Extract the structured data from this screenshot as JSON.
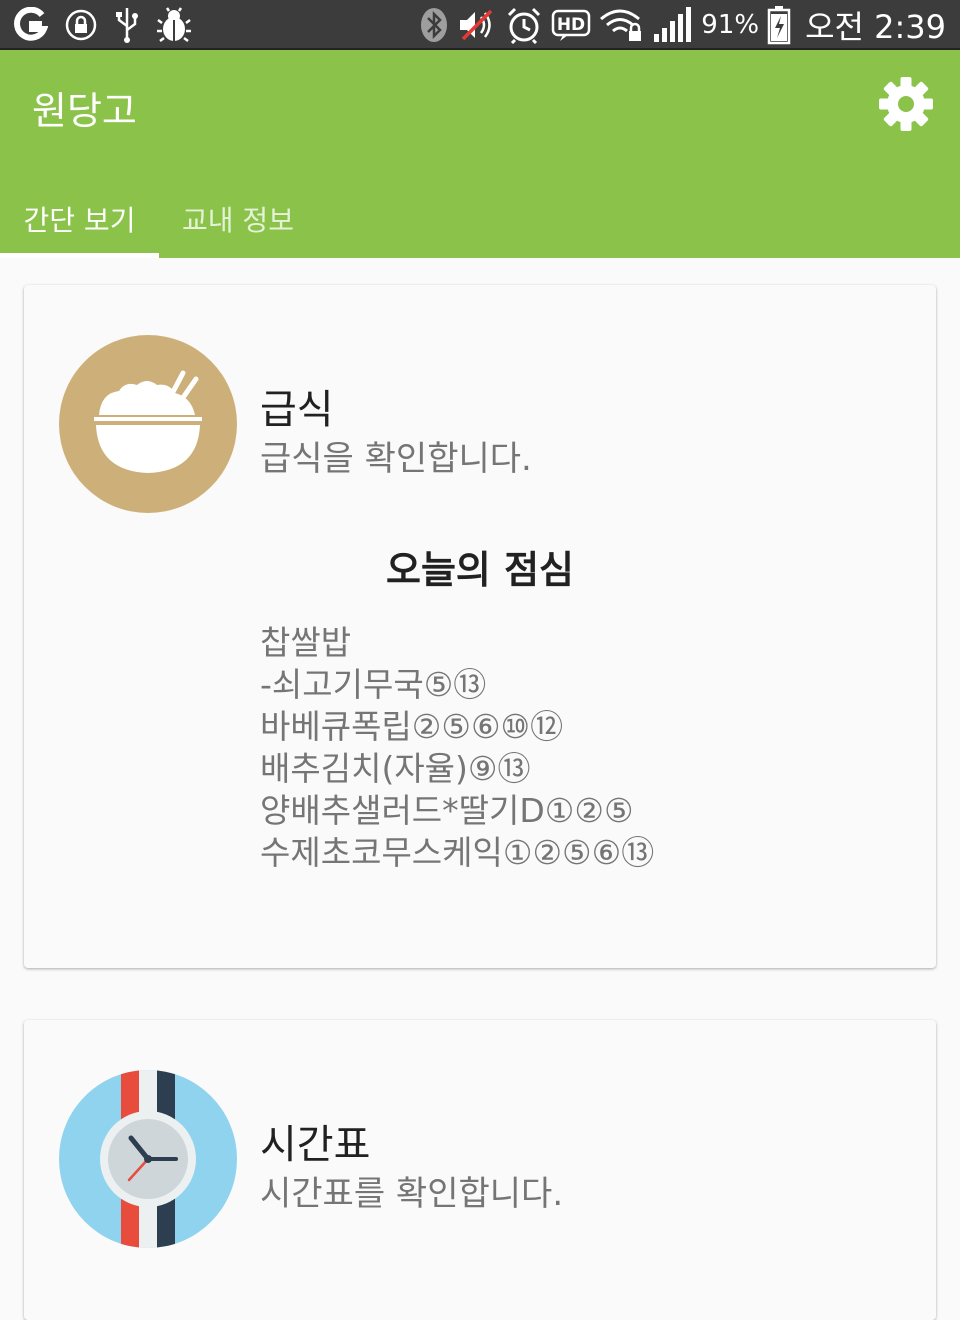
{
  "status_bar": {
    "battery": "91%",
    "time": "오전 2:39",
    "icons": [
      "app-logo-icon",
      "lock-icon",
      "usb-icon",
      "bug-icon",
      "bluetooth-icon",
      "mute-icon",
      "alarm-icon",
      "hd-icon",
      "wifi-lock-icon",
      "signal-icon",
      "battery-charging-icon"
    ]
  },
  "app_bar": {
    "title": "원당고",
    "settings_icon": "gear-icon",
    "accent_color": "#8bc34a"
  },
  "tabs": [
    {
      "label": "간단 보기",
      "active": true
    },
    {
      "label": "교내 정보",
      "active": false
    }
  ],
  "cards": {
    "meal": {
      "title": "급식",
      "subtitle": "급식을 확인합니다.",
      "icon": "rice-bowl-icon",
      "icon_color": "#cdb079",
      "lunch_heading": "오늘의 점심",
      "menu": [
        "찹쌀밥",
        "-쇠고기무국⑤⑬",
        "바베큐폭립②⑤⑥⑩⑫",
        "배추김치(자율)⑨⑬",
        "양배추샐러드*딸기D①②⑤",
        "수제초코무스케익①②⑤⑥⑬"
      ]
    },
    "timetable": {
      "title": "시간표",
      "subtitle": "시간표를 확인합니다.",
      "icon": "watch-icon",
      "icon_color": "#8fd3ee"
    }
  }
}
